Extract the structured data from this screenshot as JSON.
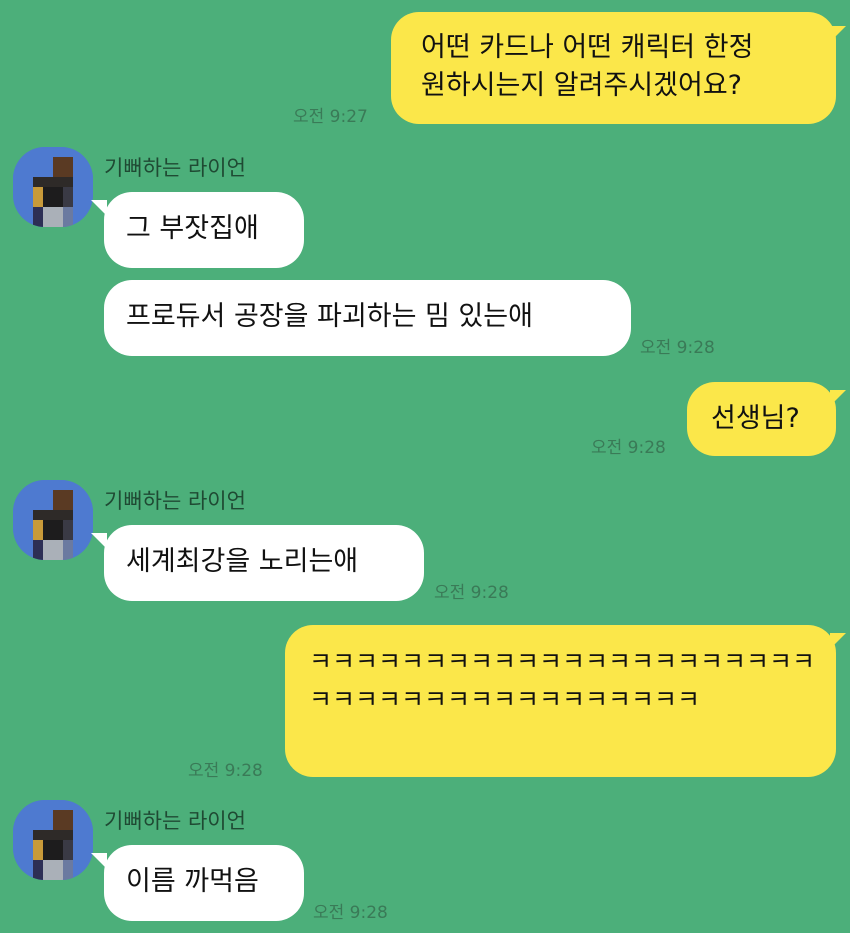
{
  "chat": {
    "sender_name": "기뻐하는 라이언",
    "messages": [
      {
        "from": "me",
        "text": "어떤 카드나 어떤 캐릭터 한정\n원하시는지 알려주시겠어요?",
        "time": "오전 9:27"
      },
      {
        "from": "them",
        "text": "그 부잣집애",
        "time": ""
      },
      {
        "from": "them",
        "text": "프로듀서 공장을 파괴하는 밈 있는애",
        "time": "오전 9:28"
      },
      {
        "from": "me",
        "text": "선생님?",
        "time": "오전 9:28"
      },
      {
        "from": "them",
        "text": "세계최강을 노리는애",
        "time": "오전 9:28"
      },
      {
        "from": "me",
        "text": "ㅋㅋㅋㅋㅋㅋㅋㅋㅋㅋㅋㅋㅋㅋㅋㅋㅋㅋㅋㅋㅋㅋㅋㅋㅋㅋㅋㅋㅋㅋㅋㅋㅋㅋㅋㅋㅋㅋㅋ",
        "time": "오전 9:28"
      },
      {
        "from": "them",
        "text": "이름 까먹음",
        "time": "오전 9:28"
      }
    ]
  },
  "colors": {
    "background": "#4caf7a",
    "my_bubble": "#fbe74a",
    "their_bubble": "#ffffff"
  },
  "icons": {
    "avatar": "pixelated-avatar-icon"
  }
}
